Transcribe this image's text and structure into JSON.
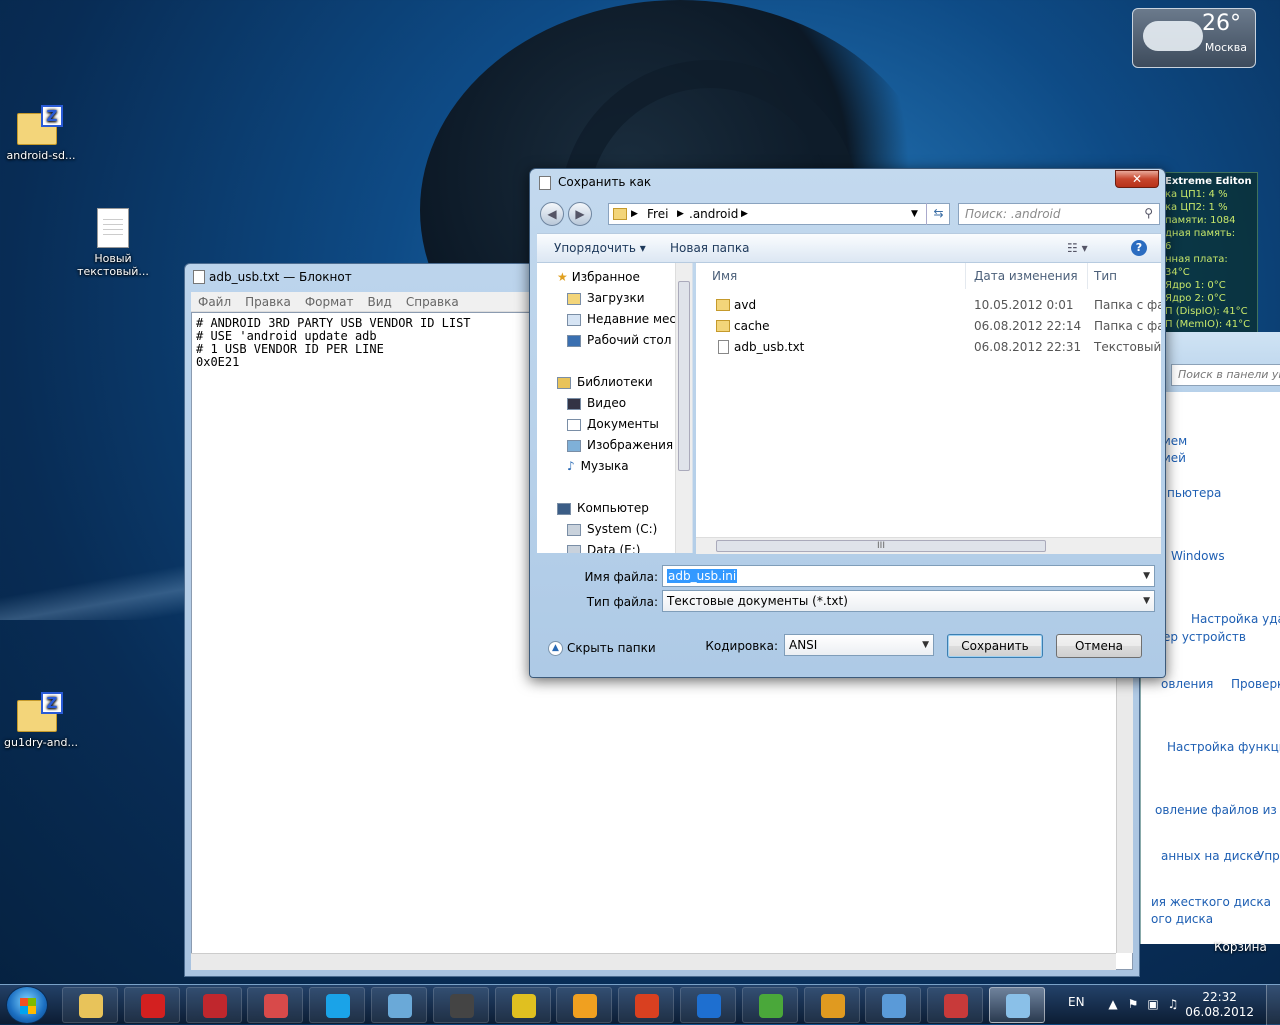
{
  "desktop": {
    "icons": [
      {
        "label": "android-sd..."
      },
      {
        "label": "Новый текстовый..."
      },
      {
        "label": "gu1dry-and..."
      }
    ],
    "recycle_bin": "Корзина"
  },
  "weather": {
    "temp": "26°",
    "city": "Москва"
  },
  "cpu_gadget": {
    "lines": [
      "Extreme Editon",
      "ка ЦП1: 4 %",
      "ка ЦП2: 1 %",
      "памяти: 1084",
      "",
      "дная память:",
      "6",
      "нная плата: 34°C",
      "Ядро 1: 0°C",
      "Ядро 2: 0°C",
      "П (DispIO): 41°C",
      "П (MemIO): 41°C"
    ]
  },
  "control_panel": {
    "search_placeholder": "Поиск в панели уп",
    "links": [
      "ием",
      "ией",
      "пьютера",
      "Windows",
      "Настройка удал",
      "ер устройств",
      "овления",
      "Проверк",
      "Настройка функций",
      "овление файлов из архи",
      "анных на диске",
      "Упра",
      "ия жесткого диска",
      "ого диска"
    ]
  },
  "notepad": {
    "title": "adb_usb.txt — Блокнот",
    "menu": [
      "Файл",
      "Правка",
      "Формат",
      "Вид",
      "Справка"
    ],
    "content": "# ANDROID 3RD PARTY USB VENDOR ID LIST\n# USE 'android update adb\n# 1 USB VENDOR ID PER LINE\n0x0E21"
  },
  "save_dialog": {
    "title": "Сохранить как",
    "close": "✕",
    "breadcrumb": [
      "Frei",
      ".android"
    ],
    "search_placeholder": "Поиск: .android",
    "toolbar": {
      "organize": "Упорядочить ▾",
      "new_folder": "Новая папка",
      "help": "?"
    },
    "nav": {
      "favorites": "Избранное",
      "downloads": "Загрузки",
      "recent": "Недавние места",
      "desktop": "Рабочий стол",
      "libraries": "Библиотеки",
      "video": "Видео",
      "documents": "Документы",
      "images": "Изображения",
      "music": "Музыка",
      "computer": "Компьютер",
      "system_c": "System (C:)",
      "data_e": "Data (E:)"
    },
    "columns": {
      "name": "Имя",
      "date": "Дата изменения",
      "type": "Тип"
    },
    "files": [
      {
        "name": "avd",
        "date": "10.05.2012 0:01",
        "type": "Папка с фай"
      },
      {
        "name": "cache",
        "date": "06.08.2012 22:14",
        "type": "Папка с фай"
      },
      {
        "name": "adb_usb.txt",
        "date": "06.08.2012 22:31",
        "type": "Текстовый д"
      }
    ],
    "filename_label": "Имя файла:",
    "filename_value": "adb_usb.ini",
    "filetype_label": "Тип файла:",
    "filetype_value": "Текстовые документы (*.txt)",
    "encoding_label": "Кодировка:",
    "encoding_value": "ANSI",
    "hide_folders": "Скрыть папки",
    "save": "Сохранить",
    "cancel": "Отмена",
    "scroll_grip": "III"
  },
  "taskbar": {
    "lang": "EN",
    "time": "22:32",
    "date": "06.08.2012",
    "apps": [
      {
        "name": "explorer",
        "color": "#e8c35a"
      },
      {
        "name": "opera",
        "color": "#d32020"
      },
      {
        "name": "pokerstars",
        "color": "#c0272d"
      },
      {
        "name": "rq",
        "color": "#d84a4a"
      },
      {
        "name": "skype",
        "color": "#1aa3e8"
      },
      {
        "name": "monitor",
        "color": "#6aa9d8"
      },
      {
        "name": "game",
        "color": "#444444"
      },
      {
        "name": "nfs",
        "color": "#e0c020"
      },
      {
        "name": "aimp",
        "color": "#f0a020"
      },
      {
        "name": "brush",
        "color": "#d94020"
      },
      {
        "name": "sync",
        "color": "#1e6fd0"
      },
      {
        "name": "utorrent",
        "color": "#4aa83a"
      },
      {
        "name": "sun",
        "color": "#e09a20"
      },
      {
        "name": "control-panel",
        "color": "#5a9ad8"
      },
      {
        "name": "toolbox",
        "color": "#c83a3a"
      },
      {
        "name": "notepad",
        "color": "#8ac0e8"
      }
    ]
  }
}
